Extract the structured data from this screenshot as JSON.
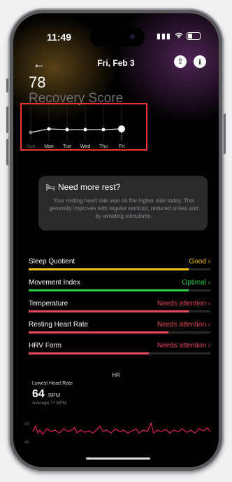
{
  "status_bar": {
    "time": "11:49"
  },
  "header": {
    "date": "Fri, Feb 3"
  },
  "score": {
    "value": "78",
    "label": "Recovery Score"
  },
  "chart_data": {
    "type": "line",
    "x": [
      "Sun",
      "Mon",
      "Tue",
      "Wed",
      "Thu",
      "Fri"
    ],
    "highlight": "Fri"
  },
  "card": {
    "title": "Need more rest?",
    "body": "Your resting heart rate was on the higher side today. This generally improves with regular workout, reduced stress and by avoiding stimulants."
  },
  "metrics": [
    {
      "label": "Sleep Quotient",
      "status": "Good",
      "color": "#f2c414",
      "level": 0.88
    },
    {
      "label": "Movement Index",
      "status": "Optimal",
      "color": "#2ecc40",
      "level": 0.88
    },
    {
      "label": "Temperature",
      "status": "Needs attention",
      "color": "#e8495a",
      "level": 0.88
    },
    {
      "label": "Resting Heart Rate",
      "status": "Needs attention",
      "color": "#e8495a",
      "level": 0.77
    },
    {
      "label": "HRV Form",
      "status": "Needs attention",
      "color": "#e8495a",
      "level": 0.66
    }
  ],
  "hr": {
    "title": "HR",
    "lowest_label": "Lowest Heart Rate",
    "lowest_value": "64",
    "unit": "BPM",
    "average": "Average 77 BPM",
    "ticks": [
      "80",
      "40"
    ],
    "line_color": "#e0215a"
  },
  "icons": {
    "back": "back-arrow-icon",
    "share": "share-icon",
    "info": "info-icon",
    "card": "bed-icon"
  }
}
